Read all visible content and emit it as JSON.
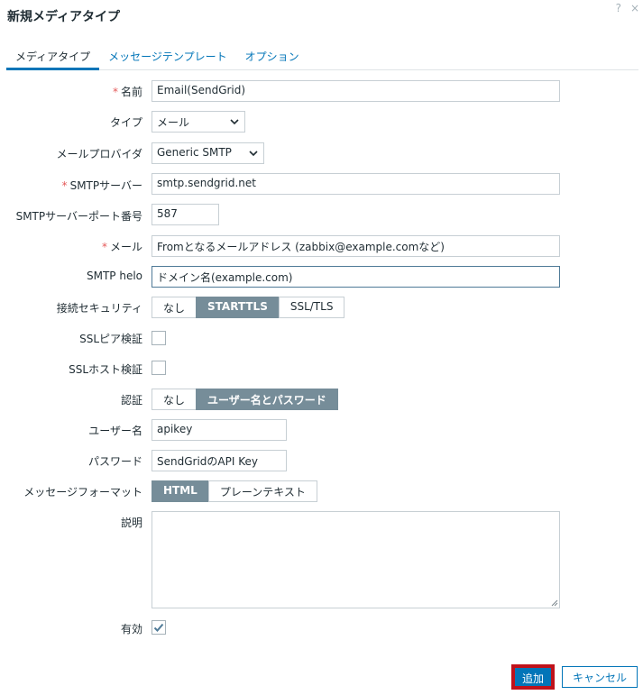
{
  "dialog": {
    "title": "新規メディアタイプ",
    "help_icon": "?",
    "close_icon": "×"
  },
  "tabs": [
    {
      "label": "メディアタイプ",
      "active": true
    },
    {
      "label": "メッセージテンプレート",
      "active": false
    },
    {
      "label": "オプション",
      "active": false
    }
  ],
  "form": {
    "name": {
      "label": "名前",
      "value": "Email(SendGrid)",
      "required": true
    },
    "type": {
      "label": "タイプ",
      "value": "メール"
    },
    "provider": {
      "label": "メールプロバイダ",
      "value": "Generic SMTP"
    },
    "smtp_server": {
      "label": "SMTPサーバー",
      "value": "smtp.sendgrid.net",
      "required": true
    },
    "smtp_port": {
      "label": "SMTPサーバーポート番号",
      "value": "587"
    },
    "email": {
      "label": "メール",
      "value": "Fromとなるメールアドレス (zabbix@example.comなど)",
      "required": true
    },
    "smtp_helo": {
      "label": "SMTP helo",
      "value": "ドメイン名(example.com)"
    },
    "security": {
      "label": "接続セキュリティ",
      "options": [
        "なし",
        "STARTTLS",
        "SSL/TLS"
      ],
      "selected": "STARTTLS"
    },
    "ssl_peer": {
      "label": "SSLピア検証",
      "checked": false
    },
    "ssl_host": {
      "label": "SSLホスト検証",
      "checked": false
    },
    "auth": {
      "label": "認証",
      "options": [
        "なし",
        "ユーザー名とパスワード"
      ],
      "selected": "ユーザー名とパスワード"
    },
    "username": {
      "label": "ユーザー名",
      "value": "apikey"
    },
    "password": {
      "label": "パスワード",
      "value": "SendGridのAPI Key"
    },
    "format": {
      "label": "メッセージフォーマット",
      "options": [
        "HTML",
        "プレーンテキスト"
      ],
      "selected": "HTML"
    },
    "description": {
      "label": "説明",
      "value": ""
    },
    "enabled": {
      "label": "有効",
      "checked": true
    }
  },
  "buttons": {
    "add": "追加",
    "cancel": "キャンセル"
  },
  "colors": {
    "accent": "#0275b8",
    "segment_selected": "#768d99",
    "required": "#e45959",
    "highlight_border": "#c0121b"
  }
}
